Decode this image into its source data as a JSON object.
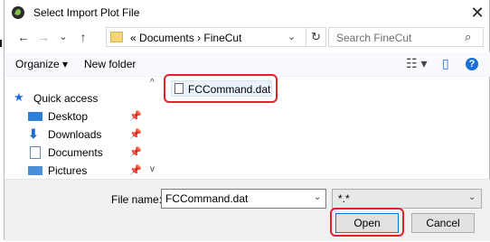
{
  "window": {
    "title": "Select Import Plot File",
    "close_glyph": "✕"
  },
  "nav": {
    "back": "←",
    "forward": "→",
    "recent": "⌄",
    "up": "↑"
  },
  "address": {
    "prefix": "«",
    "segments": [
      "Documents",
      "FineCut"
    ],
    "separator": "›",
    "dropdown": "⌄",
    "refresh": "↻"
  },
  "search": {
    "placeholder": "Search FineCut",
    "icon": "⌕"
  },
  "toolbar": {
    "organize": "Organize ▾",
    "new_folder": "New folder",
    "view_icon": "☷ ▾",
    "pane_icon": "▯",
    "help": "?"
  },
  "sidebar": {
    "items": [
      {
        "label": "Quick access",
        "icon": "star-icon",
        "pinned": false
      },
      {
        "label": "Desktop",
        "icon": "desktop-icon",
        "pinned": true
      },
      {
        "label": "Downloads",
        "icon": "download-icon",
        "pinned": true
      },
      {
        "label": "Documents",
        "icon": "documents-icon",
        "pinned": true
      },
      {
        "label": "Pictures",
        "icon": "pictures-icon",
        "pinned": true
      }
    ],
    "pin_glyph": "📌"
  },
  "files": [
    {
      "name": "FCCommand.dat"
    }
  ],
  "bottom": {
    "file_name_label": "File name:",
    "file_name_value": "FCCommand.dat",
    "file_type_value": "*.*",
    "open": "Open",
    "cancel": "Cancel"
  },
  "colors": {
    "highlight": "#e2212e",
    "accent": "#0078d7"
  }
}
